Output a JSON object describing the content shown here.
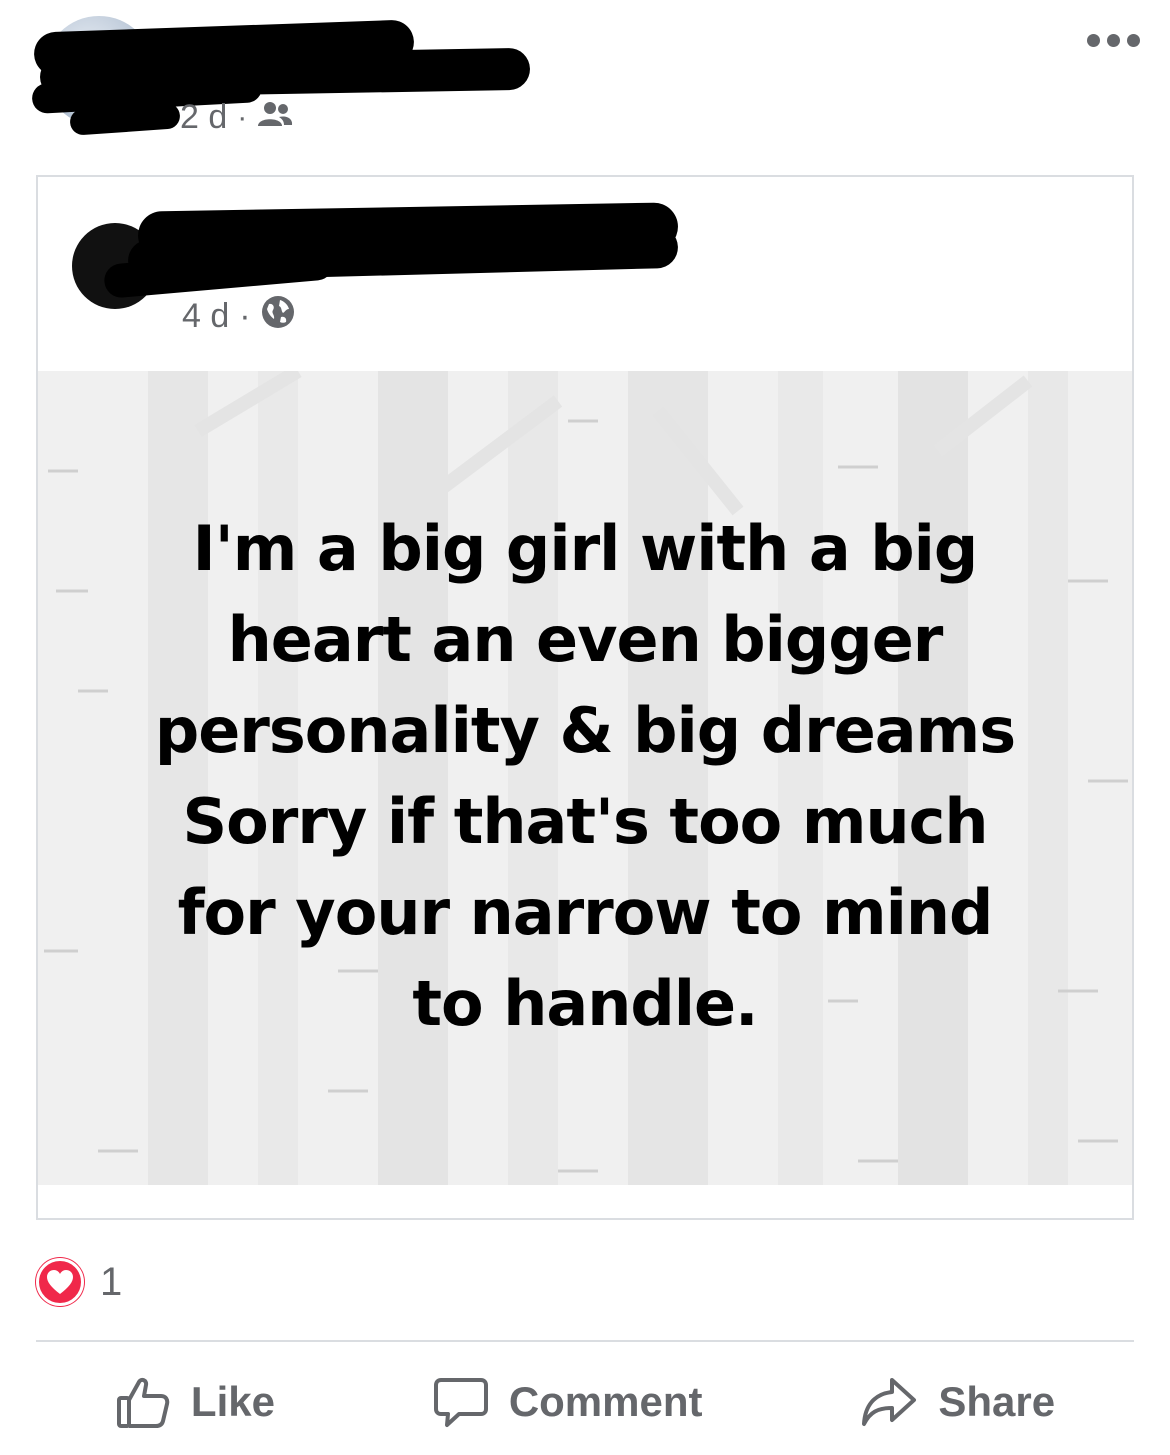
{
  "post": {
    "time": "2 d",
    "separator": "·",
    "privacy_icon": "friends-icon"
  },
  "shared_post": {
    "time": "4 d",
    "separator": "·",
    "privacy_icon": "globe-icon",
    "quote_text": "I'm a big girl with a big\nheart an even bigger\npersonality & big dreams\nSorry if that's too much\nfor your narrow to mind\nto handle."
  },
  "reactions": {
    "icon": "heart-icon",
    "count": "1",
    "color": "#f0284a"
  },
  "actions": {
    "like_label": "Like",
    "comment_label": "Comment",
    "share_label": "Share"
  }
}
